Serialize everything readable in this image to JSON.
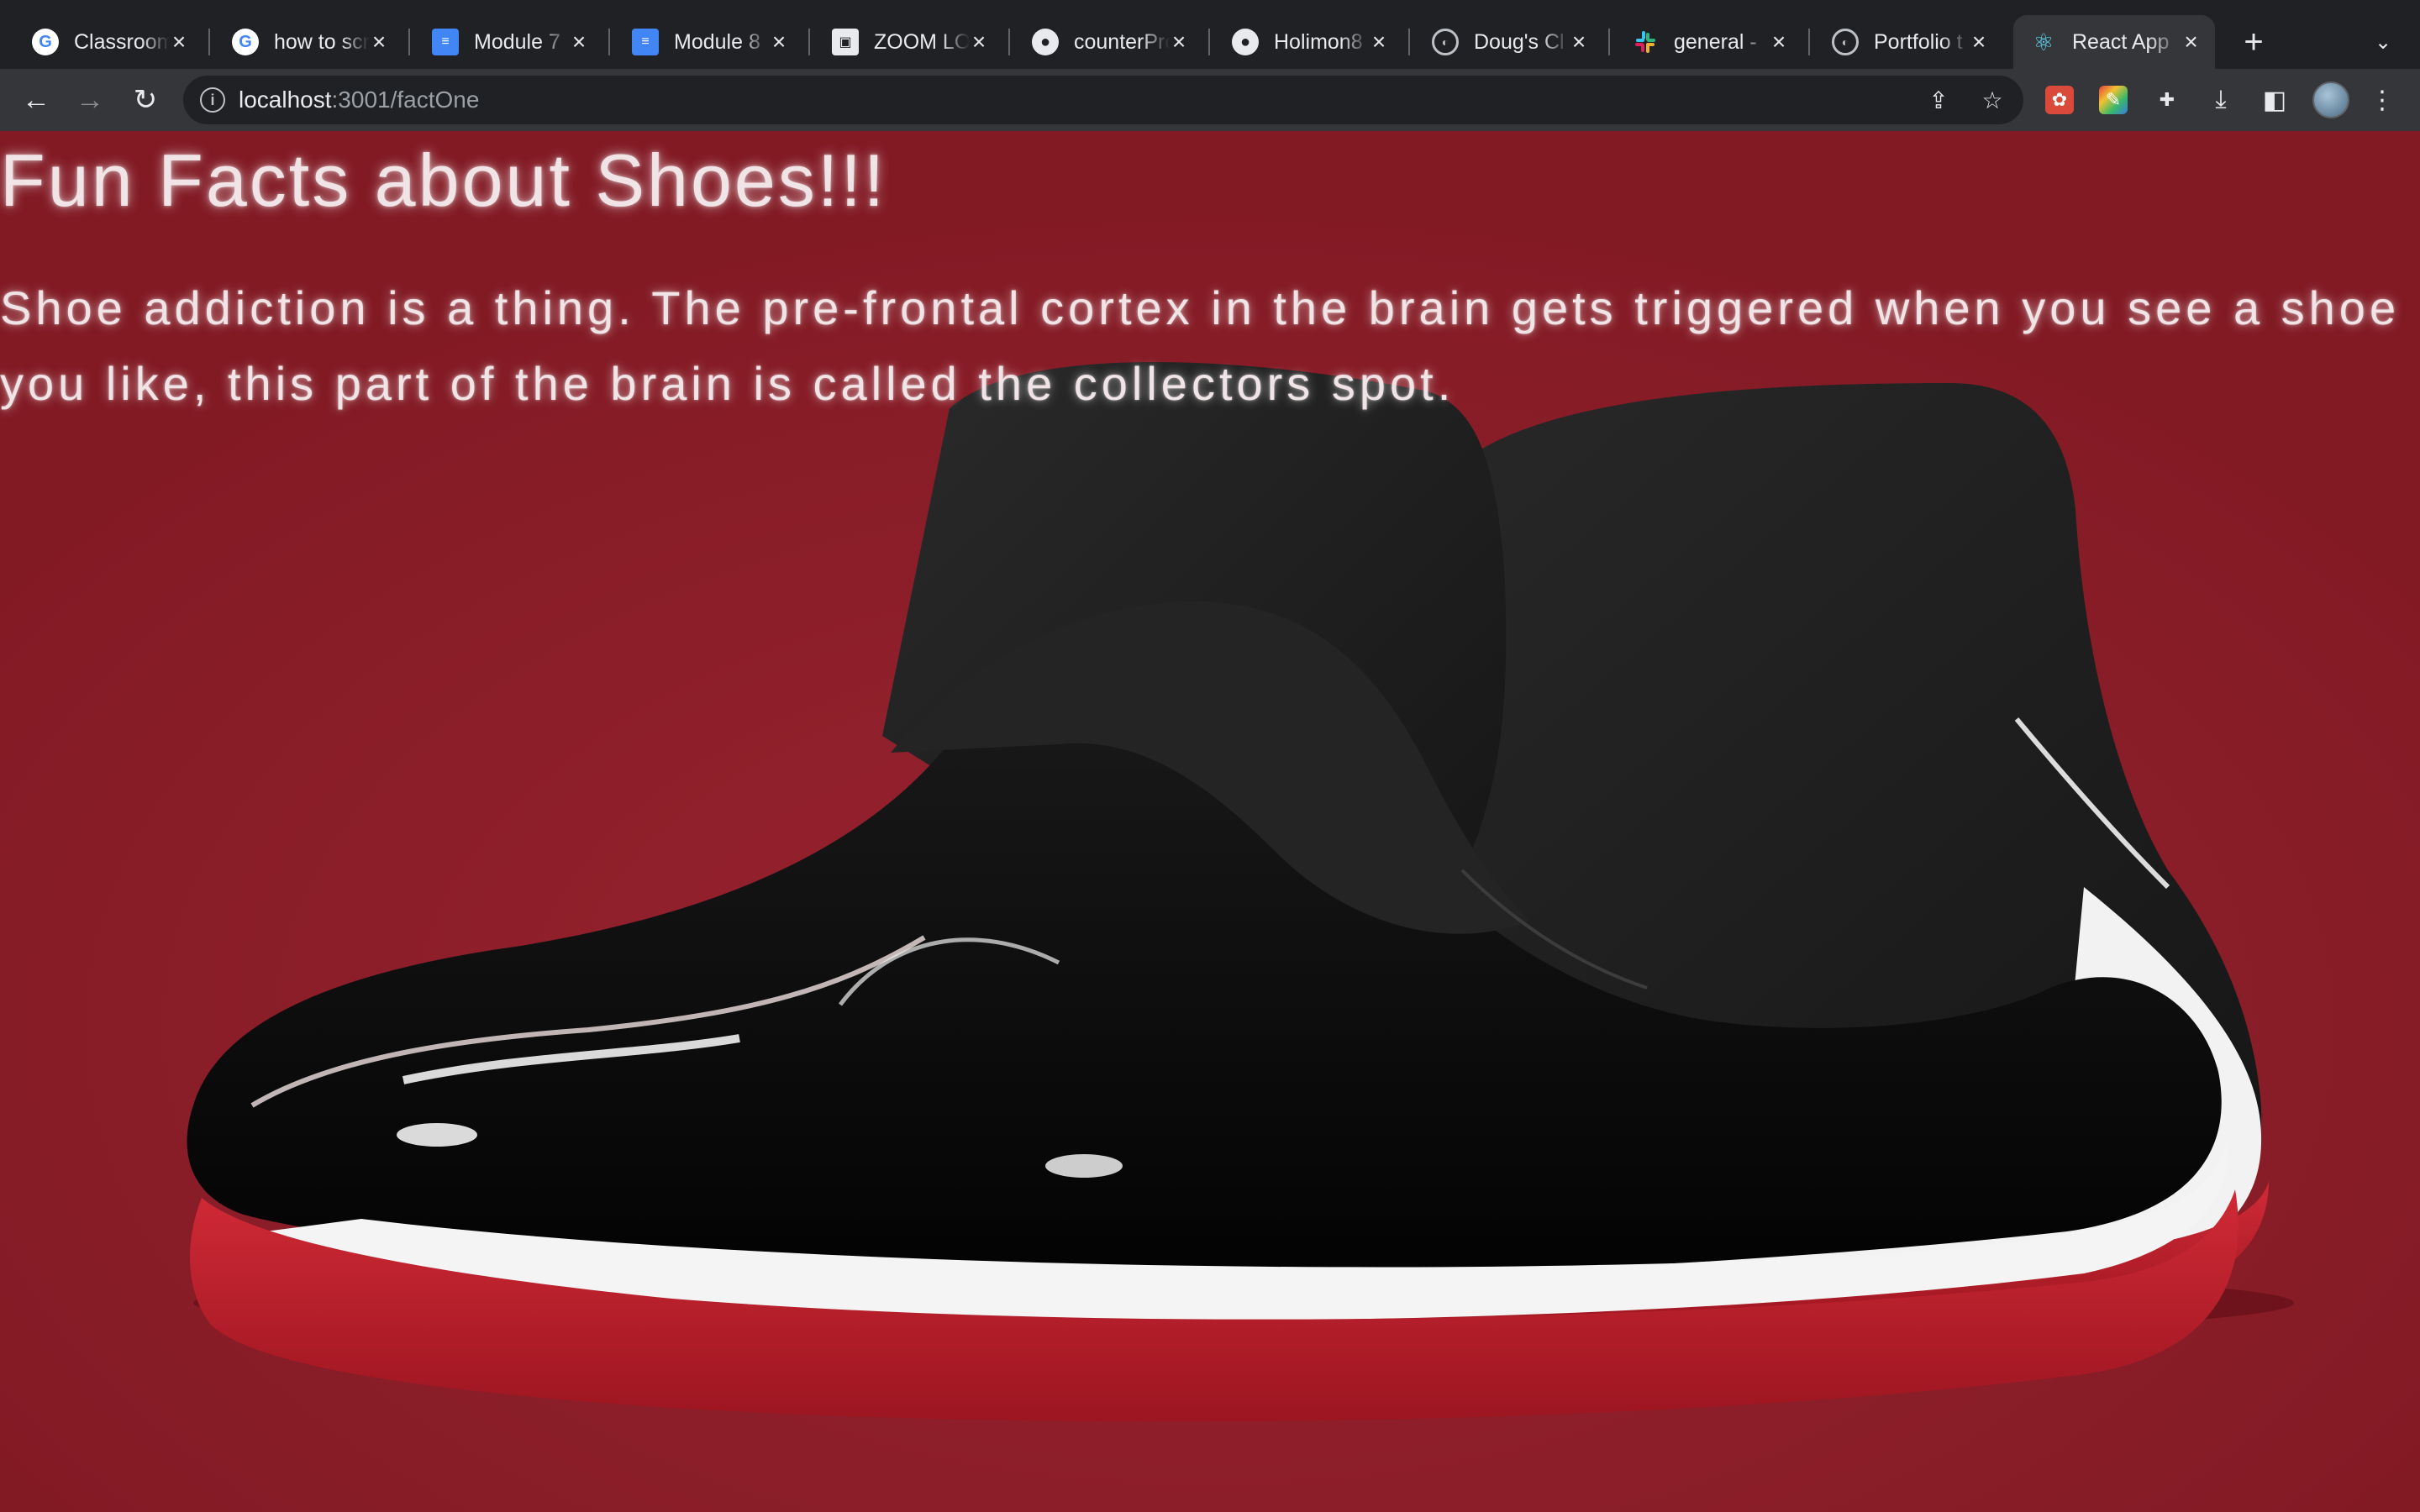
{
  "browser": {
    "tabs": [
      {
        "title": "Classroom",
        "icon": "google-icon",
        "active": false
      },
      {
        "title": "how to scroll",
        "icon": "google-icon",
        "active": false
      },
      {
        "title": "Module 7",
        "icon": "docs-icon",
        "active": false
      },
      {
        "title": "Module 8",
        "icon": "docs-icon",
        "active": false
      },
      {
        "title": "ZOOM LOGIN",
        "icon": "zoom-icon",
        "active": false
      },
      {
        "title": "counterProject",
        "icon": "github-icon",
        "active": false
      },
      {
        "title": "Holimon8",
        "icon": "github-icon",
        "active": false
      },
      {
        "title": "Doug's Cl",
        "icon": "globe-icon",
        "active": false
      },
      {
        "title": "general - ",
        "icon": "slack-icon",
        "active": false
      },
      {
        "title": "Portfolio t",
        "icon": "globe-icon",
        "active": false
      },
      {
        "title": "React App",
        "icon": "react-icon",
        "active": true
      }
    ],
    "url_host": "localhost",
    "url_path": ":3001/factOne"
  },
  "page": {
    "title": "Fun Facts about Shoes!!!",
    "fact": "Shoe addiction is a thing. The pre-frontal cortex in the brain gets triggered when you see a shoe you like, this part of the brain is called the collectors spot.",
    "background_color": "#8b1e28",
    "image": "red-black-white-basketball-sneakers-pair"
  }
}
